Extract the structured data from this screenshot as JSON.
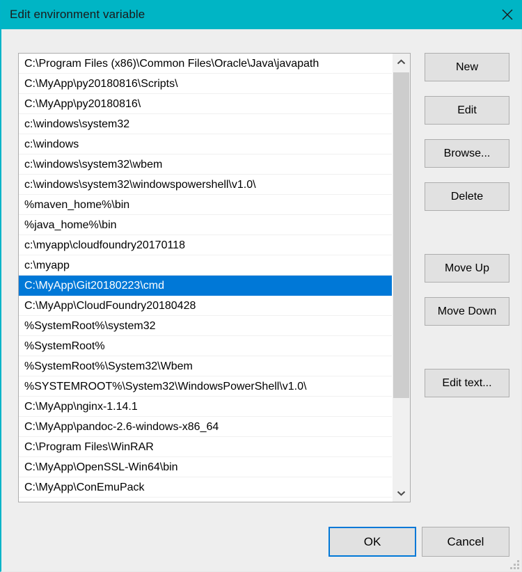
{
  "window": {
    "title": "Edit environment variable",
    "titlebar_color": "#00b5c5",
    "close_icon": "close-icon",
    "body_color": "#eeeeee"
  },
  "list": {
    "selected_index": 11,
    "selection_color": "#0078d7",
    "items": [
      "C:\\Program Files (x86)\\Common Files\\Oracle\\Java\\javapath",
      "C:\\MyApp\\py20180816\\Scripts\\",
      "C:\\MyApp\\py20180816\\",
      "c:\\windows\\system32",
      "c:\\windows",
      "c:\\windows\\system32\\wbem",
      "c:\\windows\\system32\\windowspowershell\\v1.0\\",
      "%maven_home%\\bin",
      "%java_home%\\bin",
      "c:\\myapp\\cloudfoundry20170118",
      "c:\\myapp",
      "C:\\MyApp\\Git20180223\\cmd",
      "C:\\MyApp\\CloudFoundry20180428",
      "%SystemRoot%\\system32",
      "%SystemRoot%",
      "%SystemRoot%\\System32\\Wbem",
      "%SYSTEMROOT%\\System32\\WindowsPowerShell\\v1.0\\",
      "C:\\MyApp\\nginx-1.14.1",
      "C:\\MyApp\\pandoc-2.6-windows-x86_64",
      "C:\\Program Files\\WinRAR",
      "C:\\MyApp\\OpenSSL-Win64\\bin",
      "C:\\MyApp\\ConEmuPack"
    ]
  },
  "scrollbar": {
    "up_icon": "chevron-up-icon",
    "down_icon": "chevron-down-icon"
  },
  "side_buttons": {
    "new": "New",
    "edit": "Edit",
    "browse": "Browse...",
    "delete": "Delete",
    "move_up": "Move Up",
    "move_down": "Move Down",
    "edit_text": "Edit text..."
  },
  "bottom_buttons": {
    "ok": "OK",
    "cancel": "Cancel",
    "ok_focus_color": "#0078d7"
  }
}
